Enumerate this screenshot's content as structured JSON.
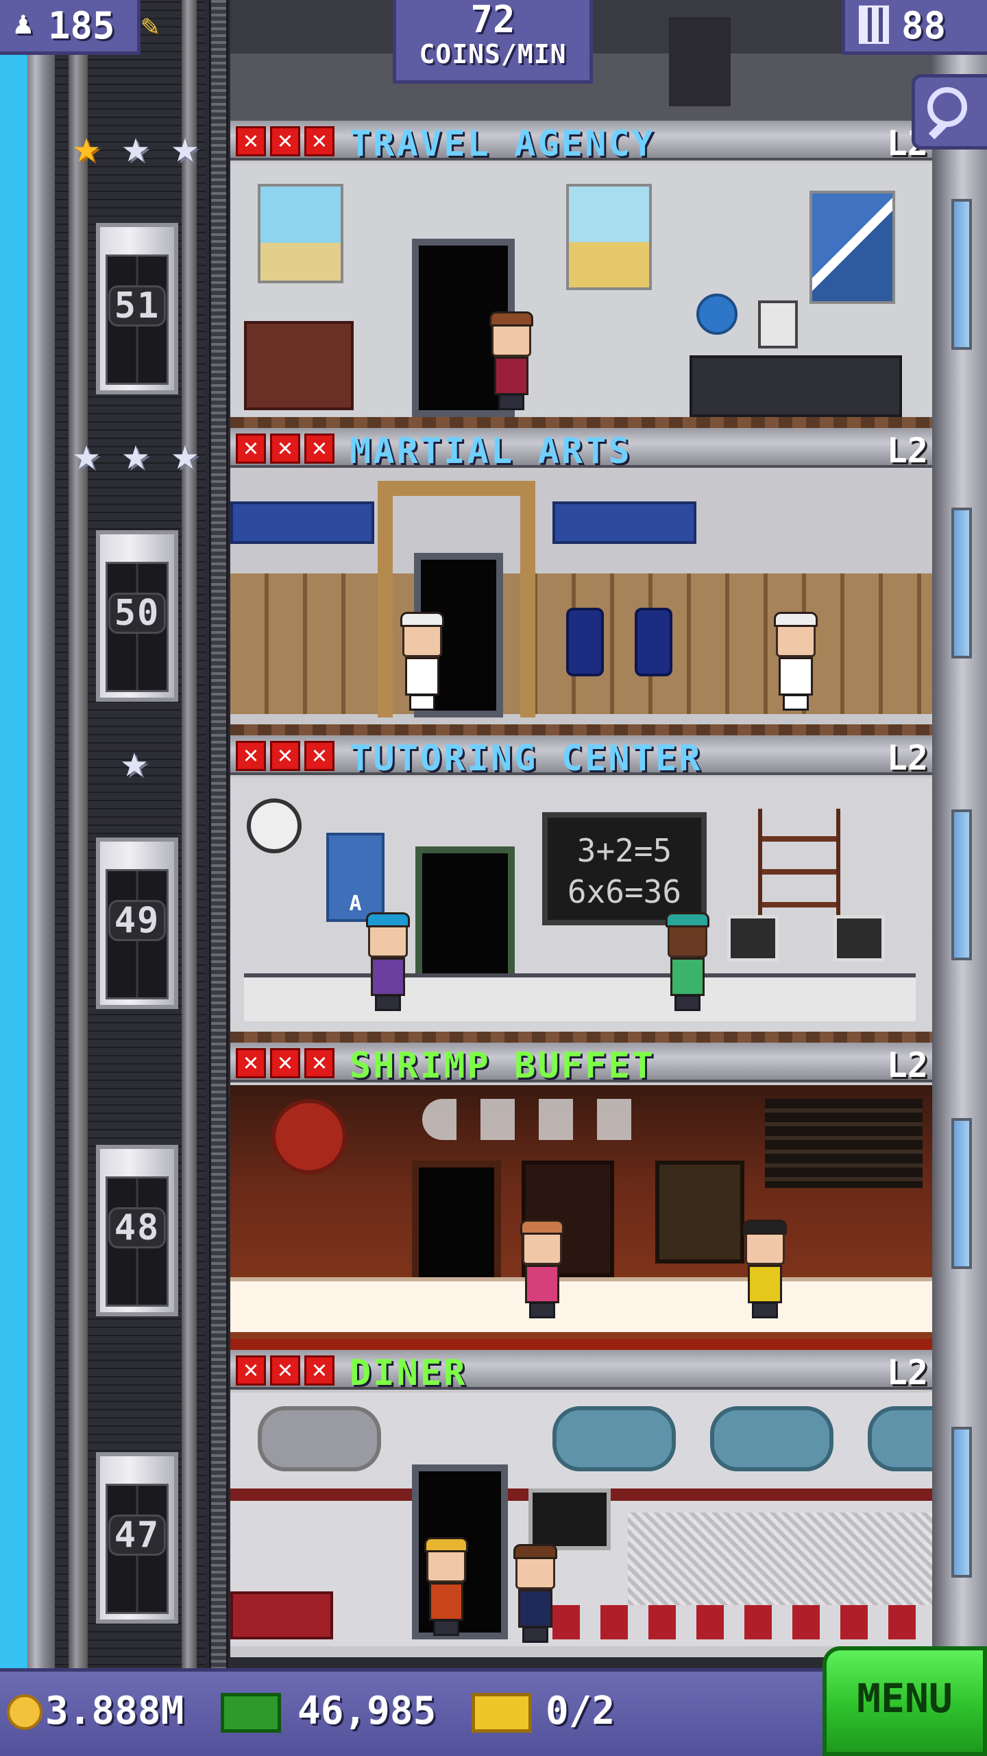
{
  "hud": {
    "population": "185",
    "rate_value": "72",
    "rate_unit": "COINS/MIN",
    "floors_count": "88"
  },
  "floors": [
    {
      "number": "51",
      "name": "TRAVEL AGENCY",
      "level": "L2",
      "name_color": "#6fd0ff",
      "stars": [
        "gold",
        "silver",
        "silver"
      ]
    },
    {
      "number": "50",
      "name": "MARTIAL ARTS",
      "level": "L2",
      "name_color": "#6fd0ff",
      "stars": [
        "silver",
        "silver",
        "silver"
      ]
    },
    {
      "number": "49",
      "name": "TUTORING CENTER",
      "level": "L2",
      "name_color": "#6fd0ff",
      "stars": [
        "silver"
      ]
    },
    {
      "number": "48",
      "name": "SHRIMP BUFFET",
      "level": "L2",
      "name_color": "#7dff47",
      "stars": []
    },
    {
      "number": "47",
      "name": "DINER",
      "level": "L2",
      "name_color": "#7dff47",
      "stars": []
    }
  ],
  "room_text": {
    "chalkboard_line1": "3+2=5",
    "chalkboard_line2": "6x6=36",
    "poster_letter": "A"
  },
  "bottom": {
    "coins": "3.888M",
    "bux": "46,985",
    "tickets": "0/2",
    "menu_label": "MENU"
  },
  "icons": {
    "population": "person-icon",
    "build": "pencil-icon",
    "floors": "building-icon",
    "search": "magnifier-icon",
    "coin": "coin-icon",
    "bux": "cash-icon",
    "ticket": "ticket-icon"
  }
}
